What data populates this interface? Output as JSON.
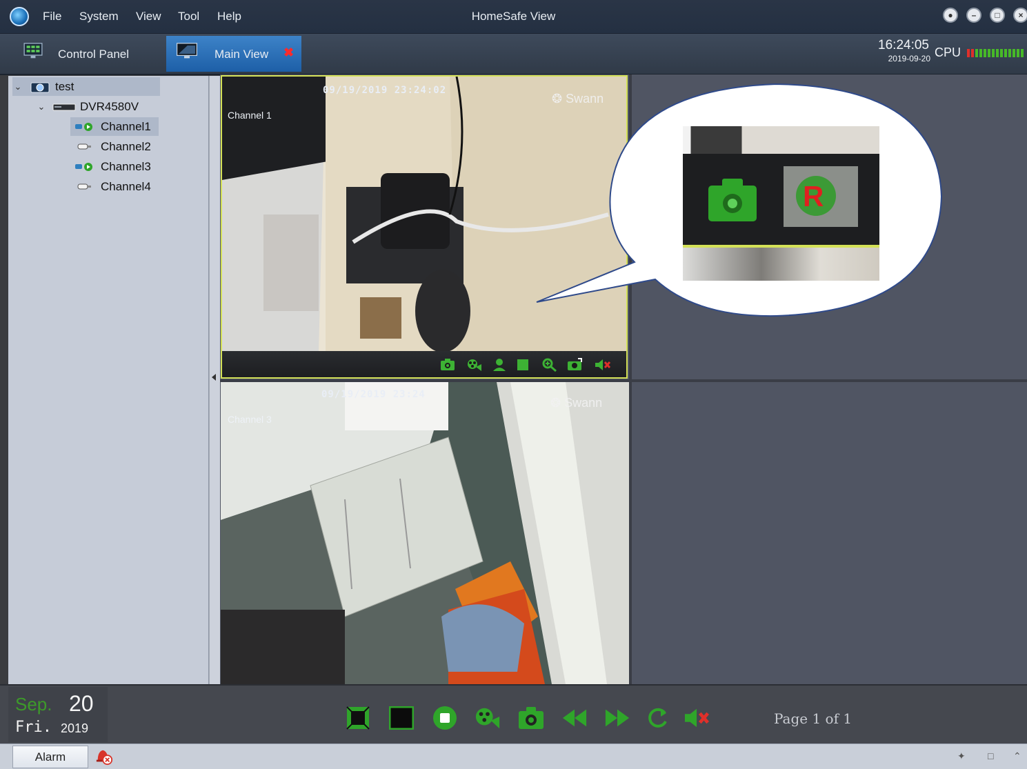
{
  "menu": {
    "items": [
      "File",
      "System",
      "View",
      "Tool",
      "Help"
    ]
  },
  "app_title": "HomeSafe View",
  "window_controls": [
    "lock-icon",
    "minimize-icon",
    "maximize-icon",
    "close-icon"
  ],
  "tabs": [
    {
      "label": "Control Panel",
      "icon": "control-panel-icon",
      "active": false
    },
    {
      "label": "Main View",
      "icon": "monitor-icon",
      "active": true,
      "closable": true
    }
  ],
  "status_top": {
    "time": "16:24:05",
    "date": "2019-09-20",
    "cpu_label": "CPU"
  },
  "device_tree": {
    "root": {
      "label": "test",
      "expanded": true
    },
    "device": {
      "label": "DVR4580V",
      "expanded": true
    },
    "channels": [
      {
        "label": "Channel1",
        "state": "active",
        "selected": true
      },
      {
        "label": "Channel2",
        "state": "inactive",
        "selected": false
      },
      {
        "label": "Channel3",
        "state": "active",
        "selected": false
      },
      {
        "label": "Channel4",
        "state": "inactive",
        "selected": false
      }
    ]
  },
  "video_panes": [
    {
      "timestamp": "09/19/2019 23:24:02",
      "name": "Channel 1",
      "brand": "Swann",
      "selected": true
    },
    {
      "timestamp": "09/19/2019 23:24",
      "name": "Channel 3",
      "brand": "Swann",
      "selected": false
    }
  ],
  "pane_toolbar": [
    "snapshot-icon",
    "record-icon",
    "user-icon",
    "stop-icon",
    "zoom-icon",
    "ptz-icon",
    "mute-icon"
  ],
  "callout": {
    "icons": [
      "snapshot-icon",
      "record-indicator-icon"
    ],
    "record_letter": "R"
  },
  "calendar": {
    "month": "Sep.",
    "day": "20",
    "weekday": "Fri.",
    "year": "2019"
  },
  "toolbar_buttons": [
    "fullscreen-icon",
    "single-view-icon",
    "stop-all-icon",
    "record-all-icon",
    "snapshot-all-icon",
    "previous-page-icon",
    "next-page-icon",
    "refresh-icon",
    "mute-all-icon"
  ],
  "page_label": "Page 1 of 1",
  "statusbar": {
    "alarm_label": "Alarm"
  },
  "colors": {
    "accent_blue": "#1d5fa7",
    "active_green": "#47b928",
    "record_red": "#d32f2f",
    "pane_highlight": "#d4e157"
  }
}
